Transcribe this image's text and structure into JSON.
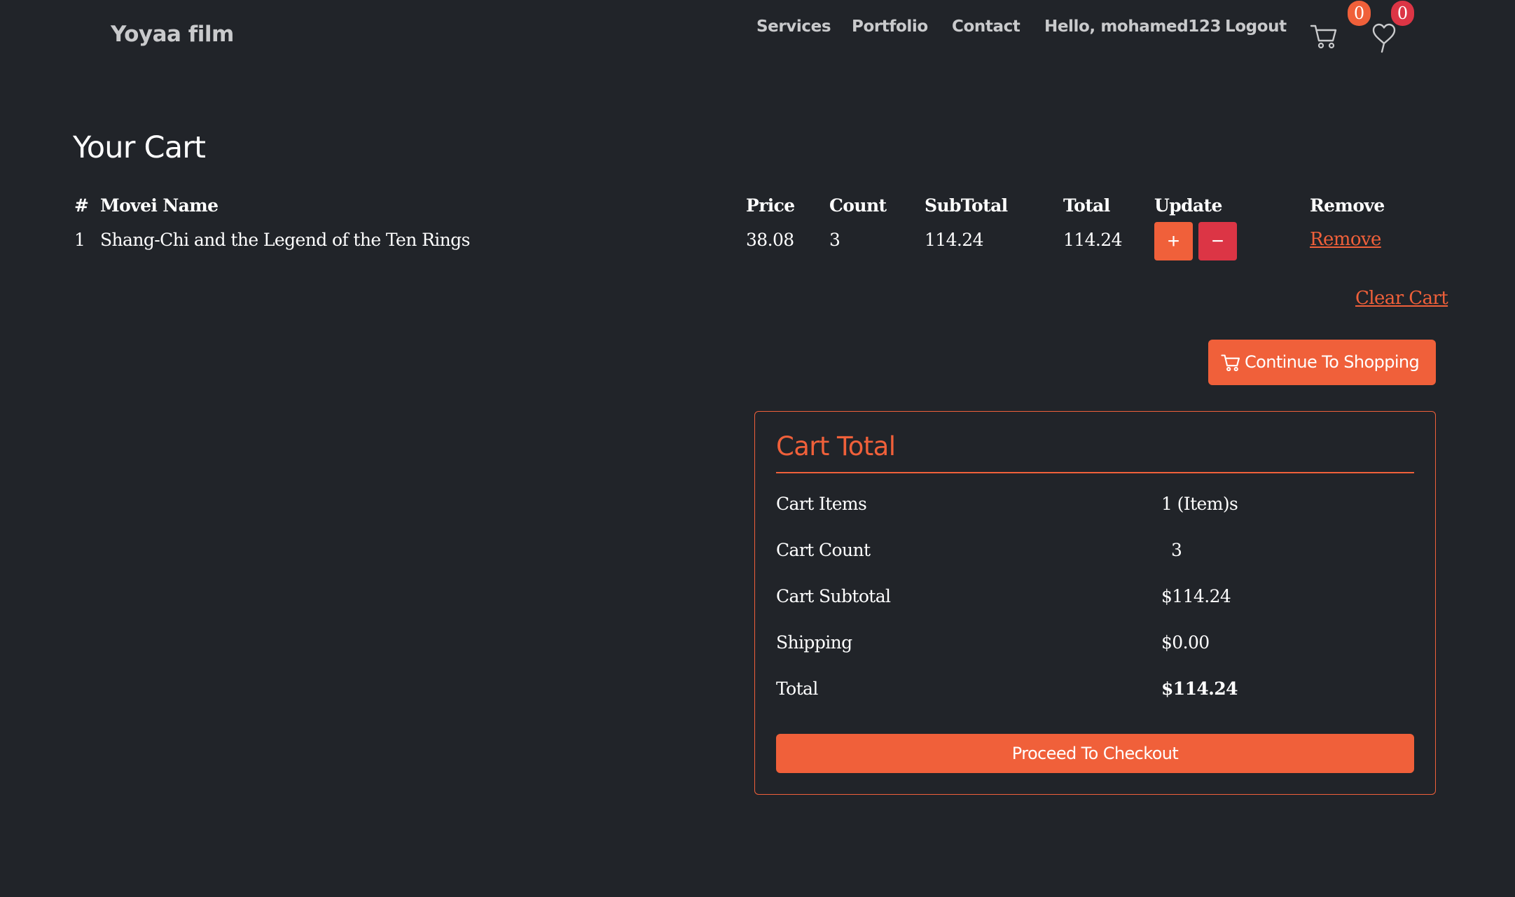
{
  "navbar": {
    "brand": "Yoyaa film",
    "links": {
      "services": "Services",
      "portfolio": "Portfolio",
      "contact": "Contact",
      "greeting": "Hello, mohamed123",
      "logout": "Logout"
    },
    "cart_badge": "0",
    "wishlist_badge": "0"
  },
  "page": {
    "title": "Your Cart"
  },
  "cart_table": {
    "headers": {
      "num": "#",
      "name": "Movei Name",
      "price": "Price",
      "count": "Count",
      "subtotal": "SubTotal",
      "total": "Total",
      "update": "Update",
      "remove": "Remove"
    },
    "rows": [
      {
        "num": "1",
        "name": "Shang-Chi and the Legend of the Ten Rings",
        "price": "38.08",
        "count": "3",
        "subtotal": "114.24",
        "total": "114.24",
        "increase_label": "+",
        "decrease_label": "−",
        "remove_label": "Remove"
      }
    ]
  },
  "actions": {
    "clear_cart": "Clear Cart",
    "continue_shopping": "Continue To Shopping"
  },
  "cart_total": {
    "title": "Cart Total",
    "items_label": "Cart Items",
    "items_value": "1 (Item)s",
    "count_label": "Cart Count",
    "count_value": "3",
    "subtotal_label": "Cart Subtotal",
    "subtotal_value": "$114.24",
    "shipping_label": "Shipping",
    "shipping_value": "$0.00",
    "total_label": "Total",
    "total_value": "$114.24",
    "checkout_label": "Proceed To Checkout"
  },
  "colors": {
    "background": "#212429",
    "accent": "#f0603a",
    "danger": "#dc3545",
    "nav_text": "#c9cacc"
  },
  "icons": {
    "cart": "cart-icon",
    "wishlist": "heart-icon"
  }
}
